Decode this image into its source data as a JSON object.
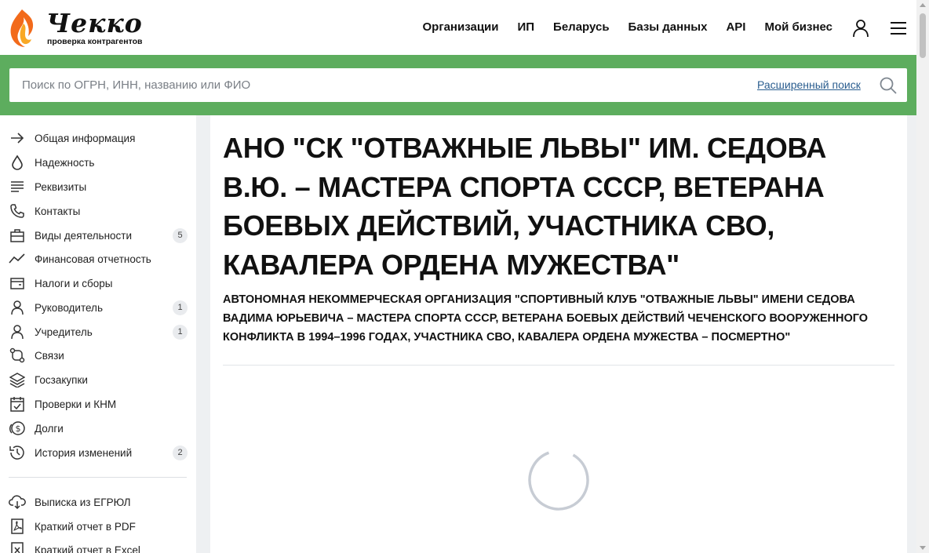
{
  "brand": {
    "name": "Чекко",
    "tagline": "проверка контрагентов",
    "accent_color": "#5dad5e",
    "flame_colors": [
      "#f26a1b",
      "#f9a825"
    ]
  },
  "nav": {
    "items": [
      "Организации",
      "ИП",
      "Беларусь",
      "Базы данных",
      "API",
      "Мой бизнес"
    ],
    "icons": [
      "user-icon",
      "menu-icon"
    ]
  },
  "search": {
    "placeholder": "Поиск по ОГРН, ИНН, названию или ФИО",
    "advanced_label": "Расширенный поиск",
    "icon": "search-icon"
  },
  "sidebar": {
    "items": [
      {
        "label": "Общая информация",
        "icon": "arrow-right-icon",
        "badge": ""
      },
      {
        "label": "Надежность",
        "icon": "drop-icon",
        "badge": ""
      },
      {
        "label": "Реквизиты",
        "icon": "lines-icon",
        "badge": ""
      },
      {
        "label": "Контакты",
        "icon": "phone-icon",
        "badge": ""
      },
      {
        "label": "Виды деятельности",
        "icon": "briefcase-icon",
        "badge": "5"
      },
      {
        "label": "Финансовая отчетность",
        "icon": "chart-line-icon",
        "badge": ""
      },
      {
        "label": "Налоги и сборы",
        "icon": "wallet-icon",
        "badge": ""
      },
      {
        "label": "Руководитель",
        "icon": "person-icon",
        "badge": "1"
      },
      {
        "label": "Учредитель",
        "icon": "person-icon",
        "badge": "1"
      },
      {
        "label": "Связи",
        "icon": "links-icon",
        "badge": ""
      },
      {
        "label": "Госзакупки",
        "icon": "layers-icon",
        "badge": ""
      },
      {
        "label": "Проверки и КНМ",
        "icon": "calendar-check-icon",
        "badge": ""
      },
      {
        "label": "Долги",
        "icon": "coins-icon",
        "badge": ""
      },
      {
        "label": "История изменений",
        "icon": "history-icon",
        "badge": "2"
      }
    ],
    "actions": [
      {
        "label": "Выписка из ЕГРЮЛ",
        "icon": "download-cloud-icon"
      },
      {
        "label": "Краткий отчет в PDF",
        "icon": "pdf-icon"
      },
      {
        "label": "Краткий отчет в Excel",
        "icon": "excel-icon"
      }
    ]
  },
  "main": {
    "title": "АНО \"СК \"ОТВАЖНЫЕ ЛЬВЫ\" ИМ. СЕДОВА В.Ю. – МАСТЕРА СПОРТА СССР, ВЕТЕРАНА БОЕВЫХ ДЕЙСТВИЙ, УЧАСТНИКА СВО, КАВАЛЕРА ОРДЕНА МУЖЕСТВА\"",
    "full_name": "АВТОНОМНАЯ НЕКОММЕРЧЕСКАЯ ОРГАНИЗАЦИЯ \"СПОРТИВНЫЙ КЛУБ \"ОТВАЖНЫЕ ЛЬВЫ\" ИМЕНИ СЕДОВА ВАДИМА ЮРЬЕВИЧА – МАСТЕРА СПОРТА СССР, ВЕТЕРАНА БОЕВЫХ ДЕЙСТВИЙ ЧЕЧЕНСКОГО ВООРУЖЕННОГО КОНФЛИКТА В 1994–1996 ГОДАХ, УЧАСТНИКА СВО, КАВАЛЕРА ОРДЕНА МУЖЕСТВА – ПОСМЕРТНО\"",
    "loading_icon": "spinner-icon"
  }
}
